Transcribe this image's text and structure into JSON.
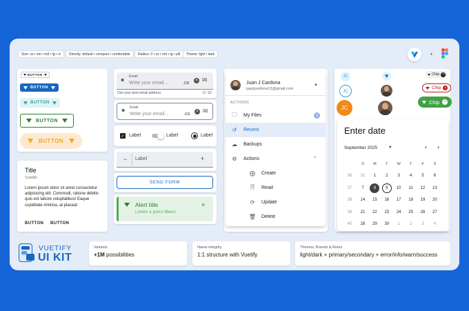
{
  "tags": {
    "size": "Size: xs • sm • md • lg • xl",
    "density": "Density: default • compact • comfortable",
    "radius": "Radius: 0 • xs • md • lg • pill",
    "theme": "Theme: light / dark"
  },
  "header": {
    "plus": "+"
  },
  "buttons": {
    "label": "BUTTON"
  },
  "card": {
    "title": "Title",
    "subtitle": "Subtitle",
    "body": "Lorem ipsum dolor sit amet consectetur adipisicing elit. Commodi, ratione debitis quis est labore voluptatibus! Eaque cupiditate minima, at placeat",
    "action1": "BUTTON",
    "action2": "BUTTON"
  },
  "form": {
    "email_label": "Email",
    "email_placeholder": "Write your email...",
    "email_suffix": ".co",
    "email_hint": "Use your best email address",
    "email_counter": "0 / 10",
    "checkbox_label": "Label",
    "switch_label": "Label",
    "radio_label": "Label",
    "stepper_minus": "−",
    "stepper_label": "Label",
    "stepper_plus": "+",
    "send_label": "SEND FORM"
  },
  "alert": {
    "title": "Alert title",
    "text": "Lorem e porro libero",
    "close": "×"
  },
  "menu": {
    "user_name": "Juan J Cardona",
    "user_email": "juanjcardona13@gmail.com",
    "section": "ACTIONS",
    "my_files": "My Files",
    "my_files_badge": "6",
    "recent": "Recent",
    "backups": "Backups",
    "actions": "Actions",
    "create": "Create",
    "read": "Read",
    "update": "Update",
    "delete": "Delete"
  },
  "avatars": {
    "initials": "JC"
  },
  "chips": {
    "label": "Chip"
  },
  "calendar": {
    "title": "Enter date",
    "month": "September 2025",
    "days": [
      "S",
      "M",
      "T",
      "W",
      "T",
      "F",
      "S"
    ],
    "weeks": [
      {
        "wk": "36",
        "cells": [
          "31",
          "1",
          "2",
          "3",
          "4",
          "5",
          "6"
        ]
      },
      {
        "wk": "37",
        "cells": [
          "7",
          "8",
          "9",
          "10",
          "11",
          "12",
          "13"
        ]
      },
      {
        "wk": "38",
        "cells": [
          "14",
          "15",
          "16",
          "17",
          "18",
          "19",
          "20"
        ]
      },
      {
        "wk": "39",
        "cells": [
          "21",
          "22",
          "23",
          "24",
          "25",
          "26",
          "27"
        ]
      },
      {
        "wk": "40",
        "cells": [
          "28",
          "29",
          "30",
          "1",
          "2",
          "3",
          "4"
        ]
      }
    ],
    "selected": "8",
    "today": "9"
  },
  "brand": {
    "line1": "VUETIFY",
    "line2": "UI KIT"
  },
  "info": {
    "variants_label": "Variants",
    "variants_value_bold": "+1M",
    "variants_value_rest": " possibilities",
    "name_label": "Name integrity",
    "name_value": "1:1 structure with Vuetify",
    "themes_label": "Themes, Brands & Roles",
    "themes_value": "light/dark + primary/secondary + error/info/warn/success"
  },
  "colors": {
    "background": "#1565d8",
    "primary": "#1867c0",
    "teal": "#2aa6a4",
    "green": "#2e7d32",
    "orange": "#f5a524",
    "red": "#b71c1c"
  }
}
